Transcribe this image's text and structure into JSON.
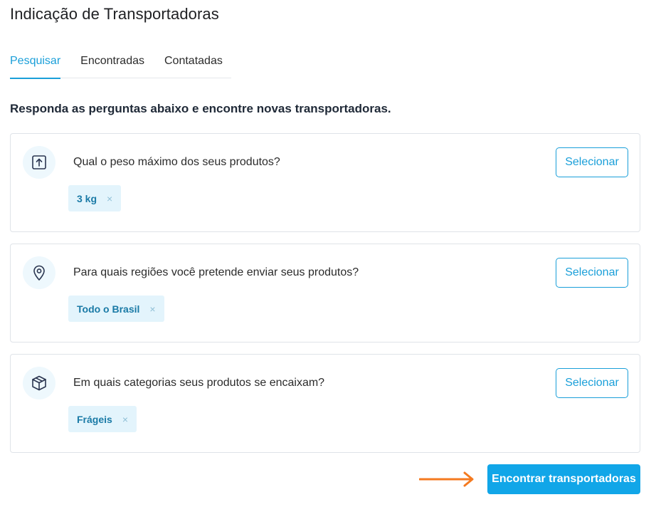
{
  "page": {
    "title": "Indicação de Transportadoras",
    "intro": "Responda as perguntas abaixo e encontre novas transportadoras."
  },
  "tabs": [
    {
      "label": "Pesquisar",
      "active": true
    },
    {
      "label": "Encontradas",
      "active": false
    },
    {
      "label": "Contatadas",
      "active": false
    }
  ],
  "questions": [
    {
      "icon": "upload-box-icon",
      "text": "Qual o peso máximo dos seus produtos?",
      "button": "Selecionar",
      "chip": "3 kg",
      "chip_remove": "×"
    },
    {
      "icon": "location-pin-icon",
      "text": "Para quais regiões você pretende enviar seus produtos?",
      "button": "Selecionar",
      "chip": "Todo o Brasil",
      "chip_remove": "×"
    },
    {
      "icon": "package-box-icon",
      "text": "Em quais categorias seus produtos se encaixam?",
      "button": "Selecionar",
      "chip": "Frágeis",
      "chip_remove": "×"
    }
  ],
  "actions": {
    "submit_label": "Encontrar transportadoras"
  },
  "colors": {
    "accent": "#1a9fd9",
    "primary_button": "#11a6e8",
    "chip_bg": "#e3f4fc",
    "arrow": "#f47a20"
  }
}
